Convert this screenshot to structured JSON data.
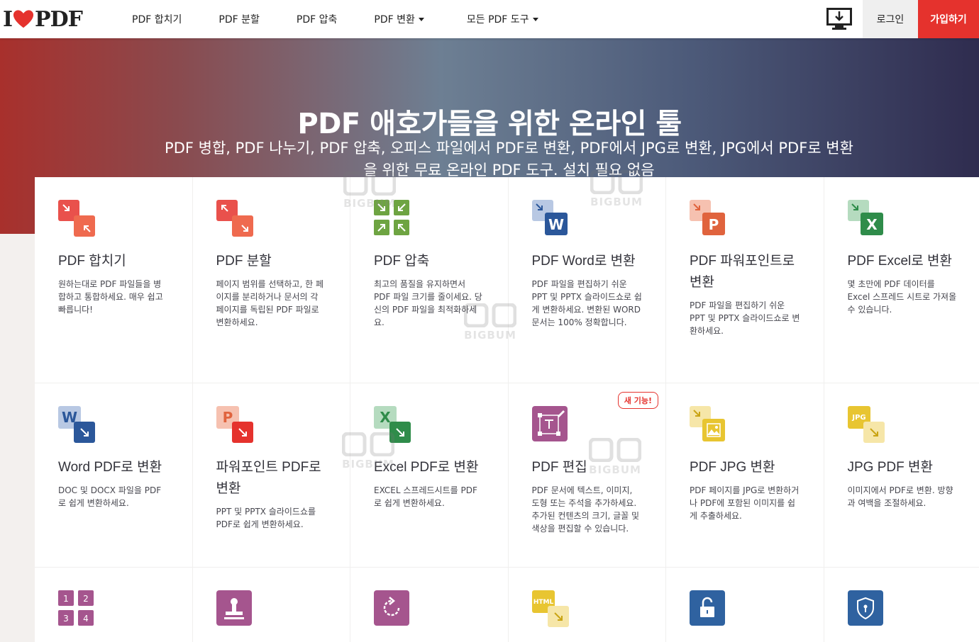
{
  "header": {
    "logo_left": "I",
    "logo_right": "PDF",
    "nav": [
      {
        "label": "PDF 합치기",
        "dropdown": false
      },
      {
        "label": "PDF 분할",
        "dropdown": false
      },
      {
        "label": "PDF 압축",
        "dropdown": false
      },
      {
        "label": "PDF 변환",
        "dropdown": true
      },
      {
        "label": "모든 PDF 도구",
        "dropdown": true
      }
    ],
    "login_label": "로그인",
    "signup_label": "가입하기"
  },
  "hero": {
    "title": "PDF 애호가들을 위한 온라인 툴",
    "subtitle": "PDF 병합, PDF 나누기, PDF 압축, 오피스 파일에서 PDF로 변환, PDF에서 JPG로 변환, JPG에서 PDF로 변환을 위한 무료 온라인 PDF 도구. 설치 필요 없음"
  },
  "tools": [
    {
      "title": "PDF 합치기",
      "desc": "원하는대로 PDF 파일들을 병합하고 통합하세요. 매우 쉽고 빠릅니다!",
      "icon": "merge-icon",
      "color": "#e5322d"
    },
    {
      "title": "PDF 분할",
      "desc": "페이지 범위를 선택하고, 한 페이지를 분리하거나 문서의 각 페이지를 독립된 PDF 파일로 변환하세요.",
      "icon": "split-icon",
      "color": "#e5322d"
    },
    {
      "title": "PDF 압축",
      "desc": "최고의 품질을 유지하면서 PDF 파일 크기를 줄이세요. 당신의 PDF 파일을 최적화하세요.",
      "icon": "compress-icon",
      "color": "#6ea442"
    },
    {
      "title": "PDF Word로 변환",
      "desc": "PDF 파일을 편집하기 쉬운 PPT 및 PPTX 슬라이드쇼로 쉽게 변환하세요. 변환된 WORD 문서는 100% 정확합니다.",
      "icon": "pdf-to-word-icon",
      "color": "#2b579a",
      "letter": "W"
    },
    {
      "title": "PDF 파워포인트로 변환",
      "desc": "PDF 파일을 편집하기 쉬운 PPT 및 PPTX 슬라이드쇼로 변환하세요.",
      "icon": "pdf-to-powerpoint-icon",
      "color": "#e0633d",
      "letter": "P"
    },
    {
      "title": "PDF Excel로 변환",
      "desc": "몇 초만에 PDF 데이터를 Excel 스프레드 시트로 가져올 수 있습니다.",
      "icon": "pdf-to-excel-icon",
      "color": "#2f8c4a",
      "letter": "X"
    },
    {
      "title": "Word PDF로 변환",
      "desc": "DOC 및 DOCX 파일을 PDF로 쉽게 변환하세요.",
      "icon": "word-to-pdf-icon",
      "color": "#2b579a",
      "letter": "W"
    },
    {
      "title": "파워포인트 PDF로 변환",
      "desc": "PPT 및 PPTX 슬라이드쇼를 PDF로 쉽게 변환하세요.",
      "icon": "powerpoint-to-pdf-icon",
      "color": "#e0633d",
      "letter": "P"
    },
    {
      "title": "Excel PDF로 변환",
      "desc": "EXCEL 스프레드시트를 PDF로 쉽게 변환하세요.",
      "icon": "excel-to-pdf-icon",
      "color": "#2f8c4a",
      "letter": "X"
    },
    {
      "title": "PDF 편집",
      "desc": "PDF 문서에 텍스트, 이미지, 도형 또는 주석을 추가하세요. 추가된 컨텐츠의 크기, 글꼴 및 색상을 편집할 수 있습니다.",
      "icon": "edit-pdf-icon",
      "color": "#a5558e",
      "badge": "새 기능!"
    },
    {
      "title": "PDF JPG 변환",
      "desc": "PDF 페이지를 JPG로 변환하거나 PDF에 포함된 이미지를 쉽게 추출하세요.",
      "icon": "pdf-to-jpg-icon",
      "color": "#e8c531"
    },
    {
      "title": "JPG PDF 변환",
      "desc": "이미지에서 PDF로 변환. 방향과 여백을 조절하세요.",
      "icon": "jpg-to-pdf-icon",
      "color": "#e8c531",
      "letter": "JPG"
    },
    {
      "title": "",
      "desc": "",
      "icon": "page-numbers-icon",
      "color": "#a5558e"
    },
    {
      "title": "",
      "desc": "",
      "icon": "stamp-icon",
      "color": "#a5558e"
    },
    {
      "title": "",
      "desc": "",
      "icon": "rotate-icon",
      "color": "#a5558e"
    },
    {
      "title": "",
      "desc": "",
      "icon": "html-to-pdf-icon",
      "color": "#e8c531",
      "letter": "HTML"
    },
    {
      "title": "",
      "desc": "",
      "icon": "unlock-icon",
      "color": "#2f62a0"
    },
    {
      "title": "",
      "desc": "",
      "icon": "protect-icon",
      "color": "#2f62a0"
    }
  ],
  "page_number_labels": [
    "1",
    "2",
    "3",
    "4"
  ],
  "watermark_text": "BIGBUM"
}
